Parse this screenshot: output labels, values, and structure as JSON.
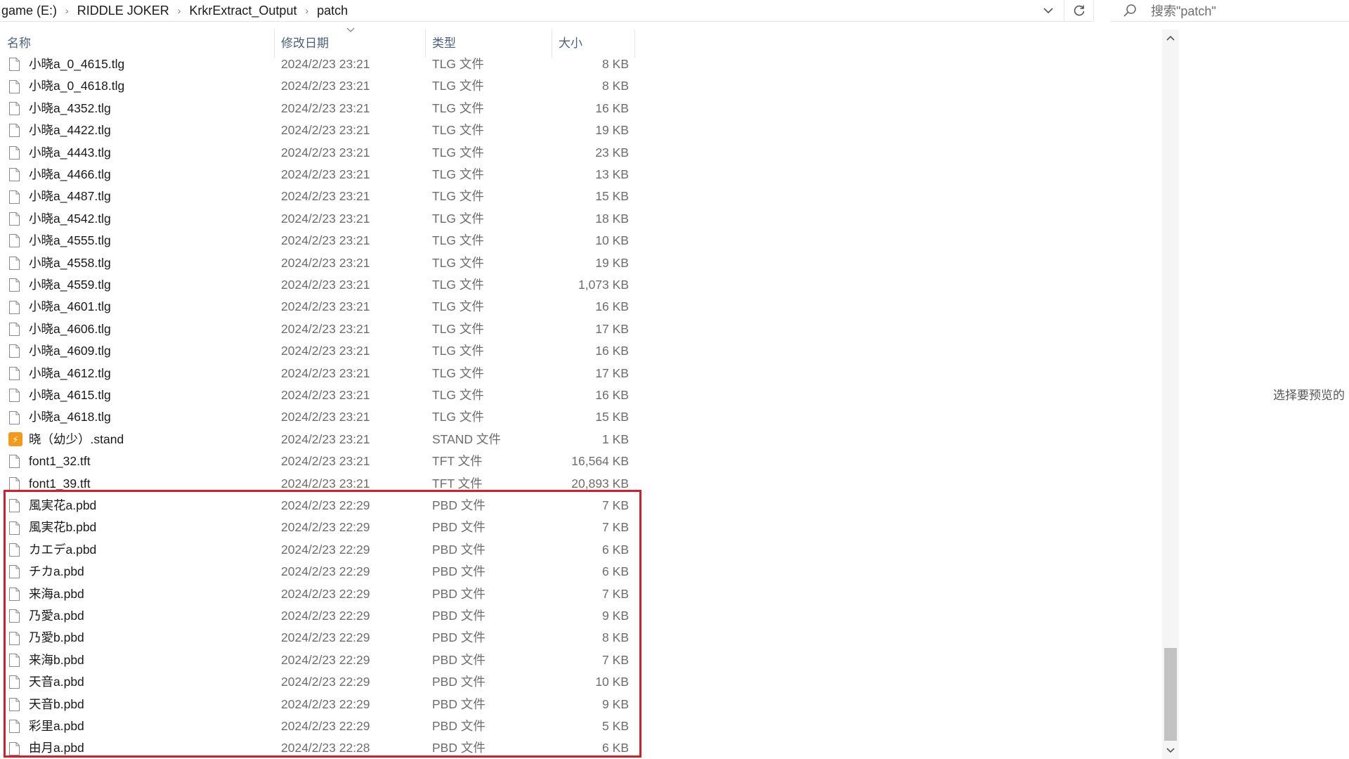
{
  "address_bar": {
    "crumbs": [
      "game (E:)",
      "RIDDLE JOKER",
      "KrkrExtract_Output",
      "patch"
    ],
    "separator": "›"
  },
  "search": {
    "placeholder": "搜索\"patch\""
  },
  "columns": {
    "name": "名称",
    "date": "修改日期",
    "type": "类型",
    "size": "大小"
  },
  "files": [
    {
      "name": "小晓a_0_4615.tlg",
      "date": "2024/2/23 23:21",
      "type": "TLG 文件",
      "size": "8 KB",
      "icon": "file-icon"
    },
    {
      "name": "小晓a_0_4618.tlg",
      "date": "2024/2/23 23:21",
      "type": "TLG 文件",
      "size": "8 KB",
      "icon": "file-icon"
    },
    {
      "name": "小晓a_4352.tlg",
      "date": "2024/2/23 23:21",
      "type": "TLG 文件",
      "size": "16 KB",
      "icon": "file-icon"
    },
    {
      "name": "小晓a_4422.tlg",
      "date": "2024/2/23 23:21",
      "type": "TLG 文件",
      "size": "19 KB",
      "icon": "file-icon"
    },
    {
      "name": "小晓a_4443.tlg",
      "date": "2024/2/23 23:21",
      "type": "TLG 文件",
      "size": "23 KB",
      "icon": "file-icon"
    },
    {
      "name": "小晓a_4466.tlg",
      "date": "2024/2/23 23:21",
      "type": "TLG 文件",
      "size": "13 KB",
      "icon": "file-icon"
    },
    {
      "name": "小晓a_4487.tlg",
      "date": "2024/2/23 23:21",
      "type": "TLG 文件",
      "size": "15 KB",
      "icon": "file-icon"
    },
    {
      "name": "小晓a_4542.tlg",
      "date": "2024/2/23 23:21",
      "type": "TLG 文件",
      "size": "18 KB",
      "icon": "file-icon"
    },
    {
      "name": "小晓a_4555.tlg",
      "date": "2024/2/23 23:21",
      "type": "TLG 文件",
      "size": "10 KB",
      "icon": "file-icon"
    },
    {
      "name": "小晓a_4558.tlg",
      "date": "2024/2/23 23:21",
      "type": "TLG 文件",
      "size": "19 KB",
      "icon": "file-icon"
    },
    {
      "name": "小晓a_4559.tlg",
      "date": "2024/2/23 23:21",
      "type": "TLG 文件",
      "size": "1,073 KB",
      "icon": "file-icon"
    },
    {
      "name": "小晓a_4601.tlg",
      "date": "2024/2/23 23:21",
      "type": "TLG 文件",
      "size": "16 KB",
      "icon": "file-icon"
    },
    {
      "name": "小晓a_4606.tlg",
      "date": "2024/2/23 23:21",
      "type": "TLG 文件",
      "size": "17 KB",
      "icon": "file-icon"
    },
    {
      "name": "小晓a_4609.tlg",
      "date": "2024/2/23 23:21",
      "type": "TLG 文件",
      "size": "16 KB",
      "icon": "file-icon"
    },
    {
      "name": "小晓a_4612.tlg",
      "date": "2024/2/23 23:21",
      "type": "TLG 文件",
      "size": "17 KB",
      "icon": "file-icon"
    },
    {
      "name": "小晓a_4615.tlg",
      "date": "2024/2/23 23:21",
      "type": "TLG 文件",
      "size": "16 KB",
      "icon": "file-icon"
    },
    {
      "name": "小晓a_4618.tlg",
      "date": "2024/2/23 23:21",
      "type": "TLG 文件",
      "size": "15 KB",
      "icon": "file-icon"
    },
    {
      "name": "晓（幼少）.stand",
      "date": "2024/2/23 23:21",
      "type": "STAND 文件",
      "size": "1 KB",
      "icon": "stand-app-icon"
    },
    {
      "name": "font1_32.tft",
      "date": "2024/2/23 23:21",
      "type": "TFT 文件",
      "size": "16,564 KB",
      "icon": "file-icon"
    },
    {
      "name": "font1_39.tft",
      "date": "2024/2/23 23:21",
      "type": "TFT 文件",
      "size": "20,893 KB",
      "icon": "file-icon"
    },
    {
      "name": "風実花a.pbd",
      "date": "2024/2/23 22:29",
      "type": "PBD 文件",
      "size": "7 KB",
      "icon": "file-icon"
    },
    {
      "name": "風実花b.pbd",
      "date": "2024/2/23 22:29",
      "type": "PBD 文件",
      "size": "7 KB",
      "icon": "file-icon"
    },
    {
      "name": "カエデa.pbd",
      "date": "2024/2/23 22:29",
      "type": "PBD 文件",
      "size": "6 KB",
      "icon": "file-icon"
    },
    {
      "name": "チカa.pbd",
      "date": "2024/2/23 22:29",
      "type": "PBD 文件",
      "size": "6 KB",
      "icon": "file-icon"
    },
    {
      "name": "来海a.pbd",
      "date": "2024/2/23 22:29",
      "type": "PBD 文件",
      "size": "7 KB",
      "icon": "file-icon"
    },
    {
      "name": "乃愛a.pbd",
      "date": "2024/2/23 22:29",
      "type": "PBD 文件",
      "size": "9 KB",
      "icon": "file-icon"
    },
    {
      "name": "乃愛b.pbd",
      "date": "2024/2/23 22:29",
      "type": "PBD 文件",
      "size": "8 KB",
      "icon": "file-icon"
    },
    {
      "name": "来海b.pbd",
      "date": "2024/2/23 22:29",
      "type": "PBD 文件",
      "size": "7 KB",
      "icon": "file-icon"
    },
    {
      "name": "天音a.pbd",
      "date": "2024/2/23 22:29",
      "type": "PBD 文件",
      "size": "10 KB",
      "icon": "file-icon"
    },
    {
      "name": "天音b.pbd",
      "date": "2024/2/23 22:29",
      "type": "PBD 文件",
      "size": "9 KB",
      "icon": "file-icon"
    },
    {
      "name": "彩里a.pbd",
      "date": "2024/2/23 22:29",
      "type": "PBD 文件",
      "size": "5 KB",
      "icon": "file-icon"
    },
    {
      "name": "由月a.pbd",
      "date": "2024/2/23 22:28",
      "type": "PBD 文件",
      "size": "6 KB",
      "icon": "file-icon"
    }
  ],
  "preview": {
    "message": "选择要预览的"
  },
  "colors": {
    "highlight": "#d21f2a",
    "header_text": "#4c607a",
    "stand_icon": "#f39a1c"
  }
}
